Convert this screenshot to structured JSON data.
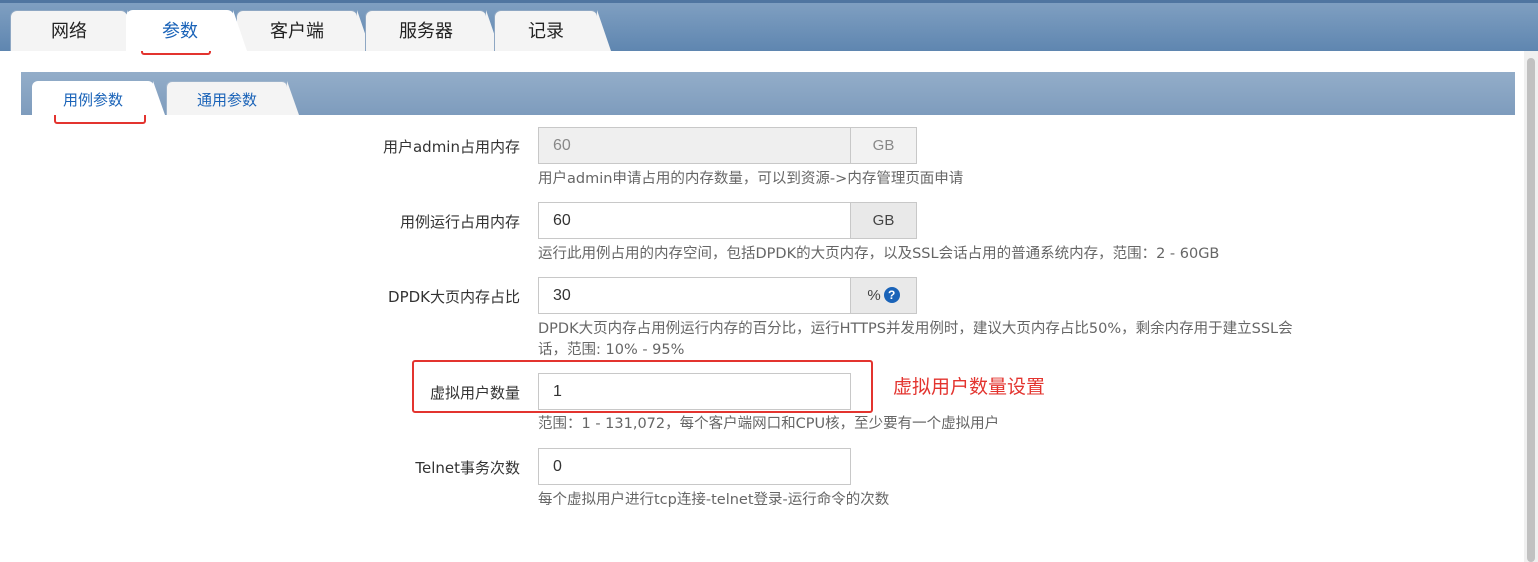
{
  "tabs": [
    "网络",
    "参数",
    "客户端",
    "服务器",
    "记录"
  ],
  "sub_tabs": [
    "用例参数",
    "通用参数"
  ],
  "fields": {
    "admin_memory": {
      "label": "用户admin占用内存",
      "value": "60",
      "unit": "GB",
      "help": "用户admin申请占用的内存数量，可以到资源->内存管理页面申请"
    },
    "case_memory": {
      "label": "用例运行占用内存",
      "value": "60",
      "unit": "GB",
      "help": "运行此用例占用的内存空间，包括DPDK的大页内存，以及SSL会话占用的普通系统内存，范围：2 - 60GB"
    },
    "dpdk_ratio": {
      "label": "DPDK大页内存占比",
      "value": "30",
      "unit": "%",
      "help_line1": "DPDK大页内存占用例运行内存的百分比，运行HTTPS并发用例时，建议大页内存占比50%，剩余内存用于建立SSL会",
      "help_line2": "话，范围: 10% - 95%"
    },
    "virtual_users": {
      "label": "虚拟用户数量",
      "value": "1",
      "help": "范围：1 - 131,072，每个客户端网口和CPU核，至少要有一个虚拟用户"
    },
    "telnet_count": {
      "label": "Telnet事务次数",
      "value": "0",
      "help": "每个虚拟用户进行tcp连接-telnet登录-运行命令的次数"
    }
  },
  "annotation": "虚拟用户数量设置",
  "icons": {
    "help": "question-circle-icon"
  },
  "colors": {
    "accent": "#1a63b8",
    "annotation": "#e3342f"
  }
}
